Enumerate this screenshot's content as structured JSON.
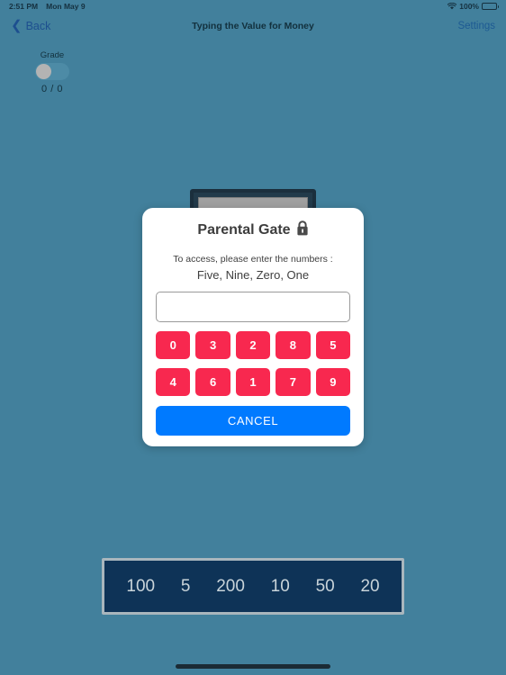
{
  "status_bar": {
    "time": "2:51 PM",
    "date": "Mon May 9",
    "wifi_icon": "wifi-icon",
    "battery_percent": "100%",
    "battery_icon": "battery-icon"
  },
  "nav_bar": {
    "back_label": "Back",
    "back_chevron": "chevron-left-icon",
    "title": "Typing the Value for Money",
    "settings_label": "Settings"
  },
  "grade_widget": {
    "label": "Grade",
    "score": "0 / 0",
    "toggle_state": "off"
  },
  "dialog": {
    "title": "Parental Gate",
    "lock_icon": "lock-icon",
    "instruction": "To access, please enter the numbers :",
    "code_words": "Five, Nine, Zero, One",
    "input_value": "",
    "input_placeholder": "",
    "keypad_rows": [
      [
        "0",
        "3",
        "2",
        "8",
        "5"
      ],
      [
        "4",
        "6",
        "1",
        "7",
        "9"
      ]
    ],
    "cancel_label": "CANCEL"
  },
  "answer_bar": {
    "values": [
      "100",
      "5",
      "200",
      "10",
      "50",
      "20"
    ]
  },
  "colors": {
    "background": "#42809c",
    "dialog_background": "#ffffff",
    "key_red": "#f8284f",
    "cancel_blue": "#007aff",
    "answer_bar_navy": "#0e3357",
    "answer_bar_border": "#a9b6bd",
    "nav_link": "#1d5a93"
  }
}
